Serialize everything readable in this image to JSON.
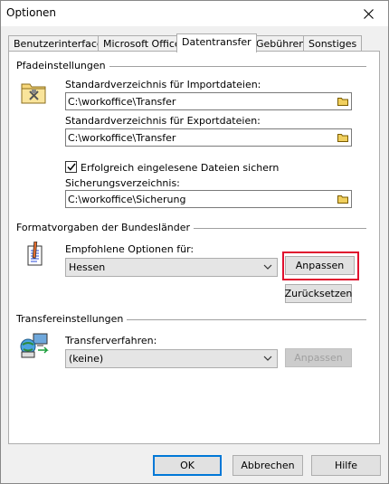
{
  "window": {
    "title": "Optionen"
  },
  "tabs": [
    {
      "label": "Benutzerinterface"
    },
    {
      "label": "Microsoft Office"
    },
    {
      "label": "Datentransfer",
      "active": true
    },
    {
      "label": "Gebühren"
    },
    {
      "label": "Sonstiges"
    }
  ],
  "paths": {
    "group_label": "Pfadeinstellungen",
    "import_label": "Standardverzeichnis für Importdateien:",
    "import_value": "C:\\workoffice\\Transfer",
    "export_label": "Standardverzeichnis für Exportdateien:",
    "export_value": "C:\\workoffice\\Transfer",
    "backup_checkbox_label": "Erfolgreich eingelesene Dateien sichern",
    "backup_checked": true,
    "backup_dir_label": "Sicherungsverzeichnis:",
    "backup_dir_value": "C:\\workoffice\\Sicherung"
  },
  "format": {
    "group_label": "Formatvorgaben der Bundesländer",
    "options_label": "Empfohlene Optionen für:",
    "selected_state": "Hessen",
    "customize_label": "Anpassen",
    "reset_label": "Zurücksetzen"
  },
  "transfer": {
    "group_label": "Transfereinstellungen",
    "method_label": "Transferverfahren:",
    "selected_method": "(keine)",
    "customize_label": "Anpassen",
    "customize_enabled": false
  },
  "footer": {
    "ok_label": "OK",
    "cancel_label": "Abbrechen",
    "help_label": "Hilfe"
  },
  "colors": {
    "highlight": "#e0102e",
    "accent": "#0078d7"
  }
}
